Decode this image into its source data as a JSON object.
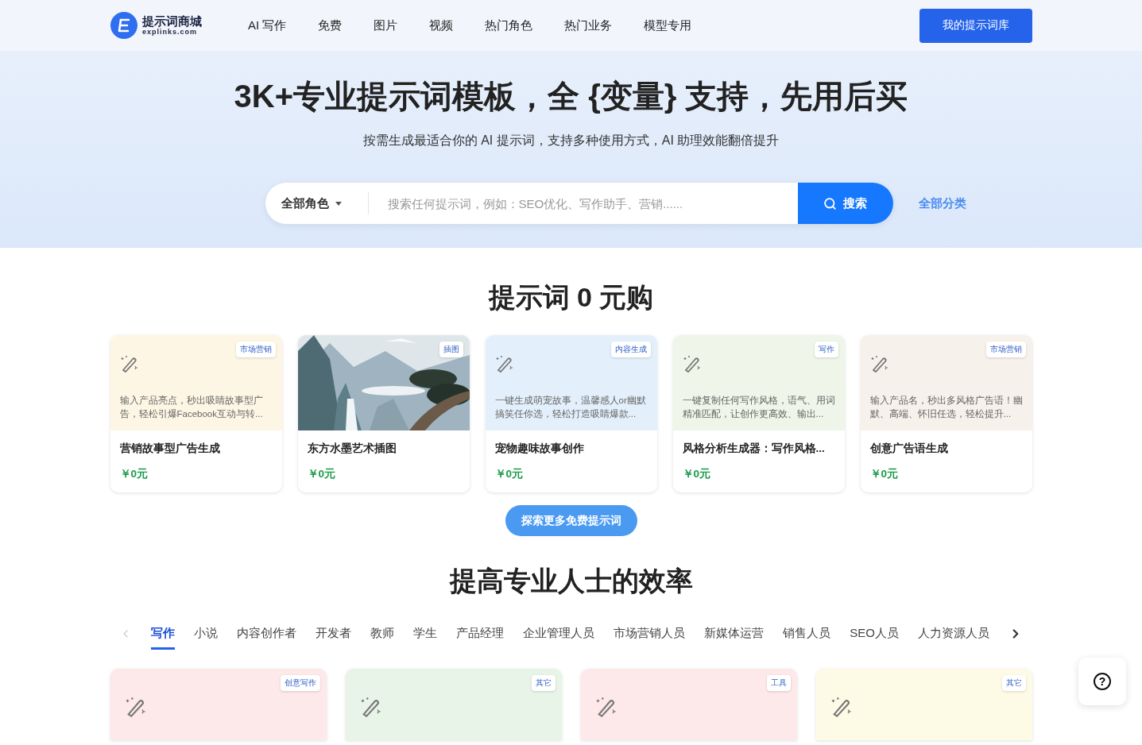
{
  "header": {
    "logo_title": "提示词商城",
    "logo_subtitle": "explinks.com",
    "nav": [
      "AI 写作",
      "免费",
      "图片",
      "视频",
      "热门角色",
      "热门业务",
      "模型专用"
    ],
    "cta": "我的提示词库"
  },
  "hero": {
    "title": "3K+专业提示词模板，全 {变量} 支持，先用后买",
    "subtitle": "按需生成最适合你的 AI 提示词，支持多种使用方式，AI 助理效能翻倍提升",
    "role_select": "全部角色",
    "search_placeholder": "搜索任何提示词，例如：SEO优化、写作助手、营销......",
    "search_button": "搜索",
    "all_categories": "全部分类"
  },
  "free_section": {
    "title": "提示词 0 元购",
    "cards": [
      {
        "kind": "icon",
        "color": "#fef6e4",
        "tag": "市场营销",
        "description": "输入产品亮点，秒出吸睛故事型广告，轻松引爆Facebook互动与转...",
        "name": "营销故事型广告生成",
        "price": "￥0元"
      },
      {
        "kind": "picture",
        "tag": "插图",
        "name": "东方水墨艺术插图",
        "price": "￥0元"
      },
      {
        "kind": "icon",
        "color": "#e3f0fc",
        "tag": "内容生成",
        "description": "一键生成萌宠故事，温馨感人or幽默搞笑任你选，轻松打造吸睛爆款...",
        "name": "宠物趣味故事创作",
        "price": "￥0元"
      },
      {
        "kind": "icon",
        "color": "#eff5e8",
        "tag": "写作",
        "description": "一键复制任何写作风格，语气、用词精准匹配，让创作更高效、输出...",
        "name": "风格分析生成器：写作风格...",
        "price": "￥0元"
      },
      {
        "kind": "icon",
        "color": "#f6f1eb",
        "tag": "市场营销",
        "description": "输入产品名，秒出多风格广告语！幽默、高端、怀旧任选，轻松提升...",
        "name": "创意广告语生成",
        "price": "￥0元"
      }
    ],
    "more_button": "探索更多免费提示词"
  },
  "pro_section": {
    "title": "提高专业人士的效率",
    "tabs": [
      {
        "label": "写作",
        "selected": true
      },
      {
        "label": "小说",
        "selected": false
      },
      {
        "label": "内容创作者",
        "selected": false
      },
      {
        "label": "开发者",
        "selected": false
      },
      {
        "label": "教师",
        "selected": false
      },
      {
        "label": "学生",
        "selected": false
      },
      {
        "label": "产品经理",
        "selected": false
      },
      {
        "label": "企业管理人员",
        "selected": false
      },
      {
        "label": "市场营销人员",
        "selected": false
      },
      {
        "label": "新媒体运营",
        "selected": false
      },
      {
        "label": "销售人员",
        "selected": false
      },
      {
        "label": "SEO人员",
        "selected": false
      },
      {
        "label": "人力资源人员",
        "selected": false
      }
    ],
    "cards": [
      {
        "color": "#fde8ea",
        "tag": "创意写作"
      },
      {
        "color": "#e8f4e8",
        "tag": "其它"
      },
      {
        "color": "#fde8ea",
        "tag": "工具"
      },
      {
        "color": "#fdfbe6",
        "tag": "其它"
      }
    ]
  },
  "help_button": "?"
}
